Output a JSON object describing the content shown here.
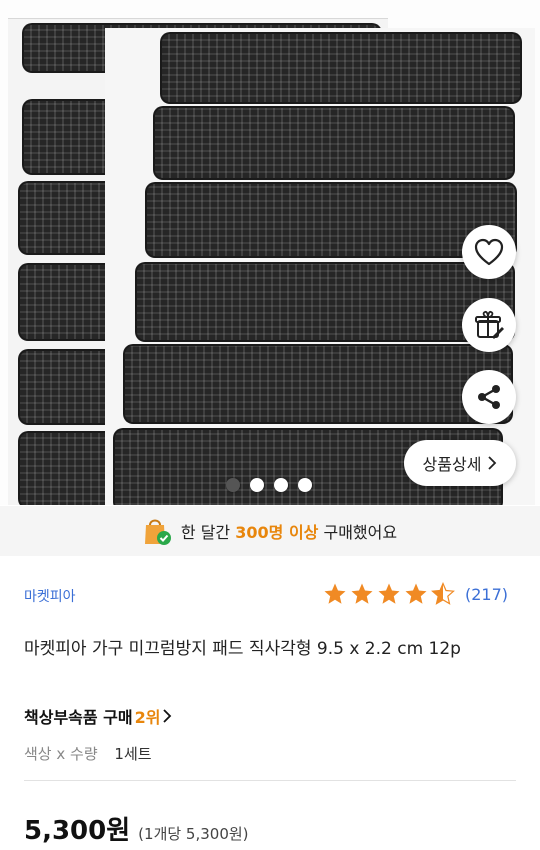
{
  "hero": {
    "image_alt": "black rectangular furniture anti-slip pads",
    "carousel_total": 4,
    "carousel_active": 1
  },
  "actions": {
    "wishlist_icon": "heart-icon",
    "gift_icon": "gift-icon",
    "share_icon": "share-icon",
    "detail_label": "상품상세"
  },
  "notice": {
    "icon": "shopping-bag-check-icon",
    "prefix": "한 달간",
    "highlight": "300명 이상",
    "suffix": "구매했어요"
  },
  "product": {
    "seller": "마켓피아",
    "rating": 4.5,
    "review_count": "(217)",
    "title": "마켓피아 가구 미끄럼방지 패드 직사각형 9.5 x 2.2 cm 12p",
    "rank_prefix": "책상부속품 구매",
    "rank_number": "2위",
    "options_label": "색상 x 수량",
    "options_value": "1세트",
    "price": "5,300원",
    "unit_price": "(1개당 5,300원)"
  },
  "colors": {
    "link_blue": "#3b6fd6",
    "accent_orange": "#e8860c",
    "star_orange": "#f08a24"
  }
}
